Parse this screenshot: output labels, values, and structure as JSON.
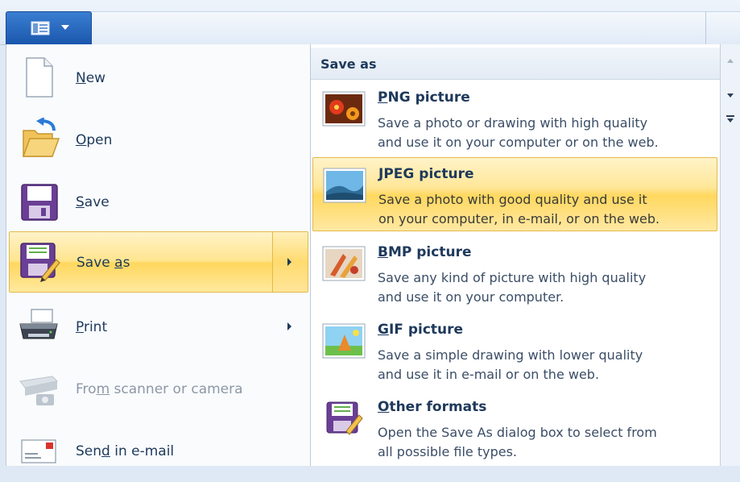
{
  "menu": {
    "items": [
      {
        "label_pre": "",
        "label_key": "N",
        "label_post": "ew",
        "icon": "new-document-icon"
      },
      {
        "label_pre": "",
        "label_key": "O",
        "label_post": "pen",
        "icon": "open-folder-icon"
      },
      {
        "label_pre": "",
        "label_key": "S",
        "label_post": "ave",
        "icon": "save-floppy-icon"
      },
      {
        "label_pre": "Save ",
        "label_key": "a",
        "label_post": "s",
        "icon": "save-as-icon"
      },
      {
        "label_pre": "",
        "label_key": "P",
        "label_post": "rint",
        "icon": "printer-icon"
      },
      {
        "label_pre": "Fro",
        "label_key": "m",
        "label_post": " scanner or camera",
        "icon": "scanner-icon"
      },
      {
        "label_pre": "Sen",
        "label_key": "d",
        "label_post": " in e-mail",
        "icon": "email-icon"
      }
    ]
  },
  "submenu": {
    "title": "Save as",
    "items": [
      {
        "title_key": "P",
        "title_post": "NG picture",
        "line1": "Save a photo or drawing with high quality",
        "line2": "and use it on your computer or on the web.",
        "icon": "png-picture-icon"
      },
      {
        "title_key": "J",
        "title_post": "PEG picture",
        "line1": "Save a photo with good quality and use it",
        "line2": "on your computer, in e-mail, or on the web.",
        "icon": "jpeg-picture-icon"
      },
      {
        "title_key": "B",
        "title_post": "MP picture",
        "line1": "Save any kind of picture with high quality",
        "line2": "and use it on your computer.",
        "icon": "bmp-picture-icon"
      },
      {
        "title_key": "G",
        "title_post": "IF picture",
        "line1": "Save a simple drawing with lower quality",
        "line2": "and use it in e-mail or on the web.",
        "icon": "gif-picture-icon"
      },
      {
        "title_key": "O",
        "title_post": "ther formats",
        "line1": "Open the Save As dialog box to select from",
        "line2": "all possible file types.",
        "icon": "other-formats-icon"
      }
    ]
  },
  "colors": {
    "highlight": "#ffd75e",
    "highlight_border": "#e3b94a",
    "app_button": "#1a56ad",
    "text": "#1e395b"
  }
}
